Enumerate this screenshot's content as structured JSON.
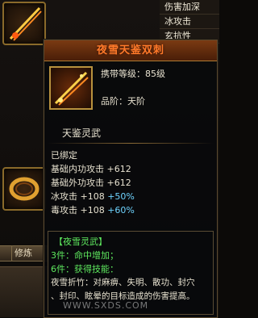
{
  "background": {
    "attributes": [
      "伤害加深",
      "冰攻击",
      "玄抗性"
    ],
    "tabs": [
      "",
      "修炼"
    ]
  },
  "tooltip": {
    "title": "夜雪天鉴双刺",
    "level_label": "携带等级：",
    "level_value": "85级",
    "grade_label": "品阶：",
    "grade_value": "天阶",
    "subtitle": "天鉴灵武",
    "bound": "已绑定",
    "stats": [
      {
        "label": "基础内功攻击",
        "value": "+612"
      },
      {
        "label": "基础外功攻击",
        "value": "+612"
      },
      {
        "label": "冰攻击",
        "value": "+108",
        "bonus": "+50%"
      },
      {
        "label": "毒攻击",
        "value": "+108",
        "bonus": "+60%"
      }
    ],
    "set_name": "【夜雪灵武】",
    "set_lines": [
      "3件：命中增加；",
      "6件：获得技能：",
      "夜雪折竹：对麻痹、失明、散功、封穴",
      "、封印、眩晕的目标造成的伤害提高。"
    ]
  },
  "watermark": "WWW.SXDS.COM",
  "colors": {
    "title": "#ff7a2a",
    "bonus": "#6fd4ff",
    "set": "#5ee85e",
    "border": "#b8923e"
  }
}
